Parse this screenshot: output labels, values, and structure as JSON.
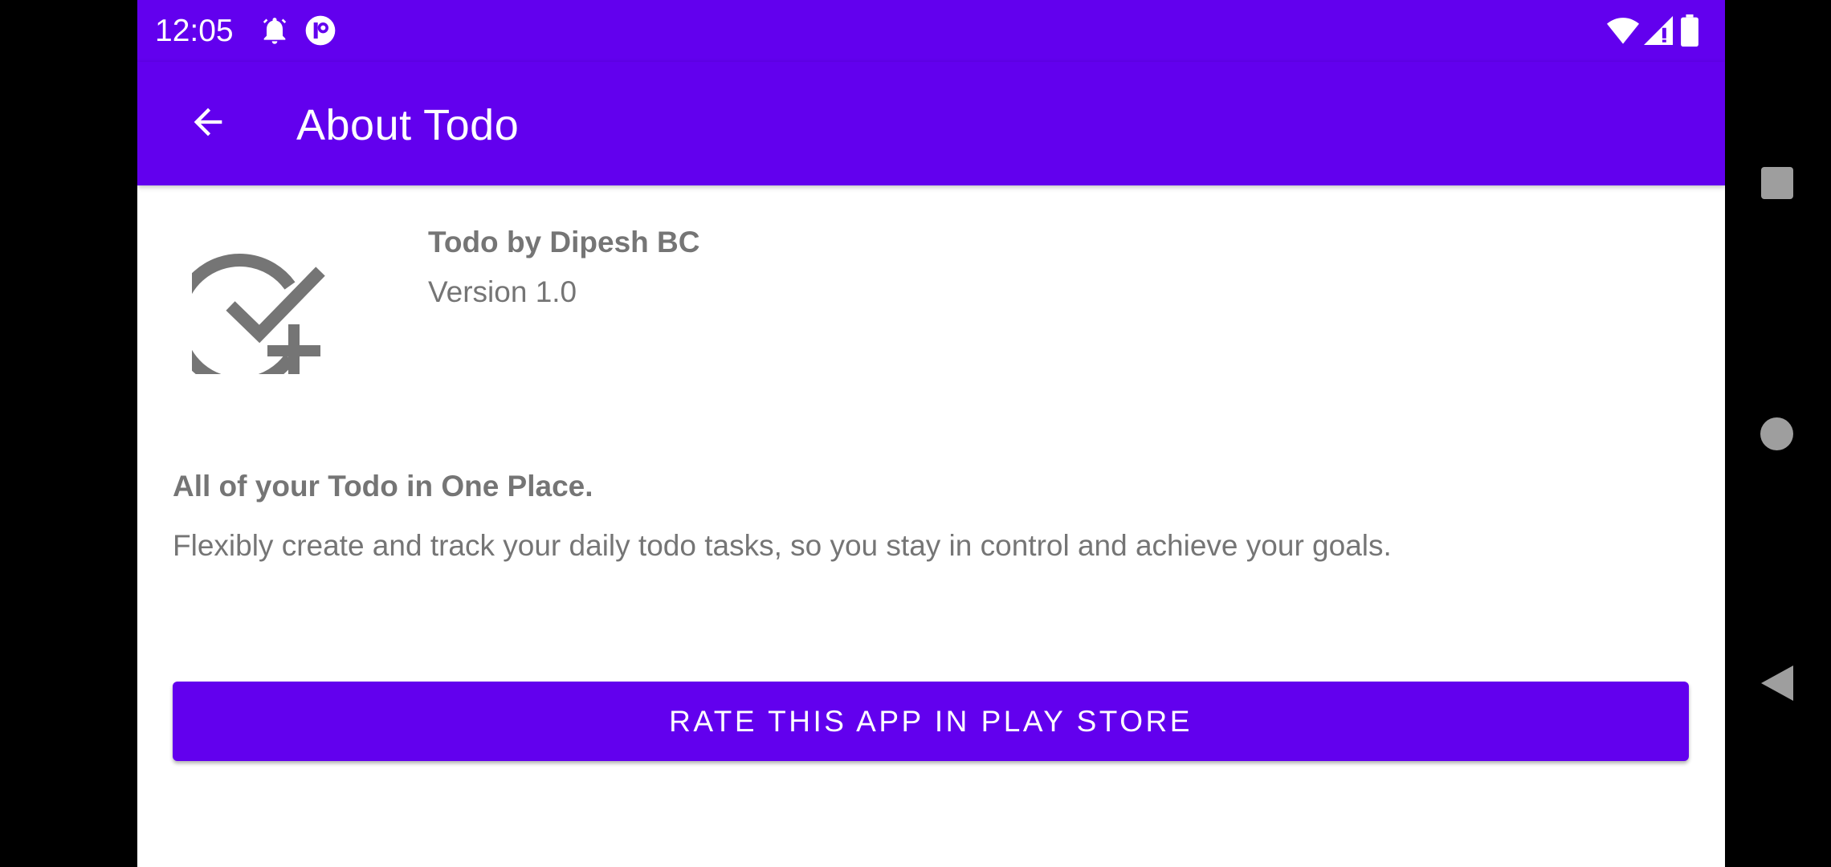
{
  "status_bar": {
    "time": "12:05",
    "icons": [
      "alarm-icon",
      "app-notification-icon",
      "wifi-icon",
      "cell-signal-icon",
      "battery-icon"
    ]
  },
  "app_bar": {
    "title": "About Todo",
    "back_icon": "arrow-back-icon"
  },
  "about": {
    "logo_icon": "check-circle-plus-icon",
    "app_name": "Todo by Dipesh BC",
    "version": "Version 1.0",
    "tagline": "All of your Todo in One Place.",
    "description": "Flexibly create and track your daily todo tasks, so you stay in control and achieve your goals."
  },
  "actions": {
    "rate_label": "RATE THIS APP IN PLAY STORE"
  },
  "nav_bar": {
    "buttons": [
      "recents-icon",
      "home-icon",
      "back-icon"
    ]
  },
  "colors": {
    "primary": "#6200ee",
    "text_secondary": "#757575",
    "nav_icon": "#9e9e9e"
  }
}
